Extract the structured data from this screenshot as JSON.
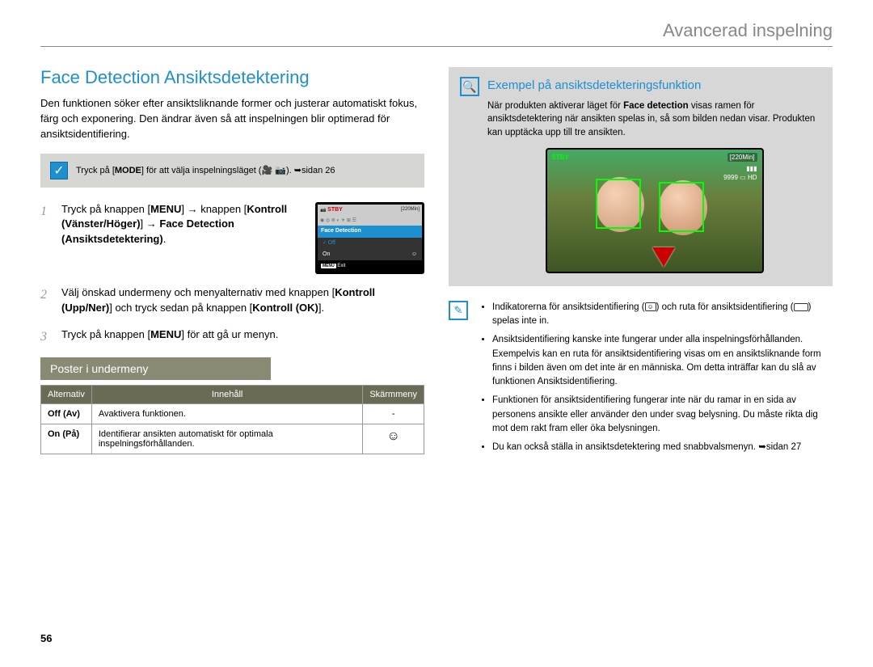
{
  "header": {
    "title": "Avancerad inspelning"
  },
  "section_title": "Face Detection Ansiktsdetektering",
  "intro": "Den funktionen söker efter ansiktsliknande former och justerar automatiskt fokus, färg och exponering. Den ändrar även så att inspelningen blir optimerad för ansiktsidentifiering.",
  "hint": {
    "prefix": "Tryck på [",
    "mode": "MODE",
    "mid": "] för att välja inspelningsläget (",
    "suffix": "). ➥sidan 26"
  },
  "menu_screenshot": {
    "stby": "STBY",
    "min": "[220Min]",
    "title": "Face Detection",
    "off": "Off",
    "on": "On",
    "exit_badge": "MENU",
    "exit": "Exit"
  },
  "steps": {
    "s1": {
      "num": "1",
      "a": "Tryck på knappen [",
      "menu": "MENU",
      "b": "] → knappen [",
      "ctrl": "Kontroll (Vänster/Höger)",
      "c": "] → ",
      "fd": "Face Detection (Ansiktsdetektering)",
      "d": "."
    },
    "s2": {
      "num": "2",
      "a": "Välj önskad undermeny och menyalternativ med knappen [",
      "ctrl": "Kontroll (Upp/Ner)",
      "b": "] och tryck sedan på knappen [",
      "ok": "Kontroll (OK)",
      "c": "]."
    },
    "s3": {
      "num": "3",
      "a": "Tryck på knappen [",
      "menu": "MENU",
      "b": "] för att gå ur menyn."
    }
  },
  "submenu_heading": "Poster i undermeny",
  "table": {
    "h_alt": "Alternativ",
    "h_inn": "Innehåll",
    "h_sk": "Skärmmeny",
    "r1_alt": "Off (Av)",
    "r1_inn": "Avaktivera funktionen.",
    "r1_sk": "-",
    "r2_alt": "On (På)",
    "r2_inn": "Identifierar ansikten automatiskt för optimala inspelningsförhållanden."
  },
  "example": {
    "title": "Exempel på ansiktsdetekteringsfunktion",
    "p1a": "När produkten aktiverar läget för ",
    "p1b": "Face detection",
    "p1c": " visas ramen för ansiktsdetektering när ansikten spelas in, så som bilden nedan visar. Produkten kan upptäcka upp till tre ansikten.",
    "preview": {
      "stby": "STBY",
      "min": "[220Min]",
      "count": "9999",
      "hd": "HD"
    }
  },
  "notes": {
    "n1a": "Indikatorerna för ansiktsidentifiering (",
    "n1b": ") och ruta för ansiktsidentifiering (",
    "n1c": ") spelas inte in.",
    "n2": "Ansiktsidentifiering kanske inte fungerar under alla inspelningsförhållanden. Exempelvis kan en ruta för ansiktsidentifiering visas om en ansiktsliknande form finns i bilden även om det inte är en människa. Om detta inträffar kan du slå av funktionen Ansiktsidentifiering.",
    "n3": "Funktionen för ansiktsidentifiering fungerar inte när du ramar in en sida av personens ansikte eller använder den under svag belysning. Du måste rikta dig mot dem rakt fram eller öka belysningen.",
    "n4": "Du kan också ställa in ansiktsdetektering med snabbvalsmenyn. ➥sidan 27"
  },
  "page_number": "56"
}
